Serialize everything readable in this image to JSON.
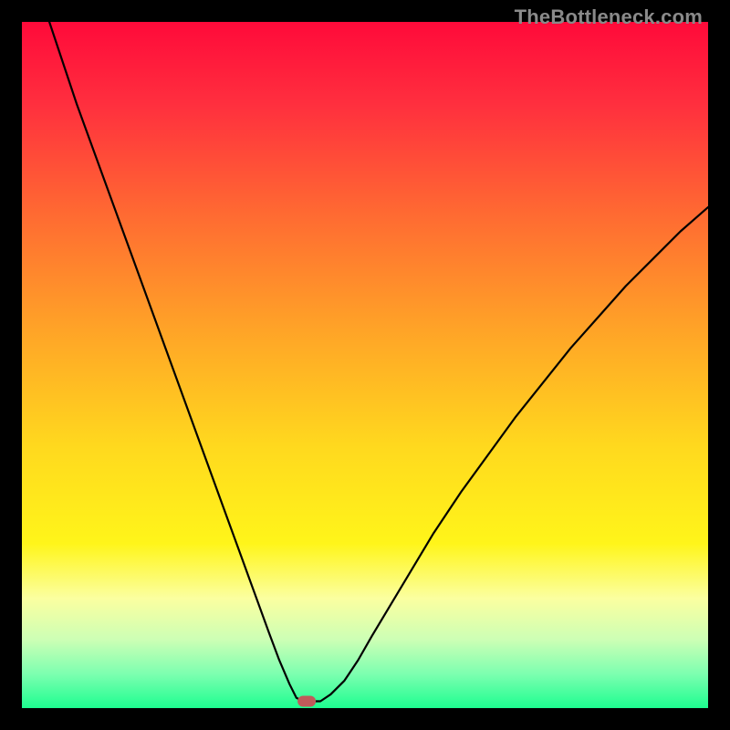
{
  "watermark": "TheBottleneck.com",
  "chart_data": {
    "type": "line",
    "title": "",
    "xlabel": "",
    "ylabel": "",
    "xlim": [
      0,
      100
    ],
    "ylim": [
      0,
      100
    ],
    "grid": false,
    "legend": false,
    "background_gradient": {
      "type": "vertical",
      "stops": [
        {
          "offset": 0.0,
          "color": "#ff0a3a"
        },
        {
          "offset": 0.12,
          "color": "#ff2f3e"
        },
        {
          "offset": 0.28,
          "color": "#ff6a32"
        },
        {
          "offset": 0.45,
          "color": "#ffa427"
        },
        {
          "offset": 0.62,
          "color": "#ffd91e"
        },
        {
          "offset": 0.76,
          "color": "#fff51a"
        },
        {
          "offset": 0.84,
          "color": "#fbffa0"
        },
        {
          "offset": 0.9,
          "color": "#cdffb5"
        },
        {
          "offset": 0.95,
          "color": "#7dffb0"
        },
        {
          "offset": 1.0,
          "color": "#1dfd90"
        }
      ]
    },
    "marker": {
      "x": 41.5,
      "y": 1.0,
      "color": "#c05a5a"
    },
    "series": [
      {
        "name": "curve",
        "stroke": "#000000",
        "stroke_width": 2.2,
        "x": [
          4.0,
          6.0,
          8.0,
          10.0,
          12.0,
          14.0,
          16.0,
          18.0,
          20.0,
          22.0,
          24.0,
          26.0,
          28.0,
          30.0,
          32.0,
          34.0,
          36.0,
          37.5,
          39.0,
          40.0,
          41.0,
          43.5,
          45.0,
          47.0,
          49.0,
          51.0,
          54.0,
          57.0,
          60.0,
          64.0,
          68.0,
          72.0,
          76.0,
          80.0,
          84.0,
          88.0,
          92.0,
          96.0,
          100.0
        ],
        "y": [
          100.0,
          94.0,
          88.0,
          82.5,
          77.0,
          71.5,
          66.0,
          60.5,
          55.0,
          49.5,
          44.0,
          38.5,
          33.0,
          27.5,
          22.0,
          16.5,
          11.0,
          7.0,
          3.5,
          1.5,
          1.0,
          1.0,
          2.0,
          4.0,
          7.0,
          10.5,
          15.5,
          20.5,
          25.5,
          31.5,
          37.0,
          42.5,
          47.5,
          52.5,
          57.0,
          61.5,
          65.5,
          69.5,
          73.0
        ]
      }
    ]
  }
}
